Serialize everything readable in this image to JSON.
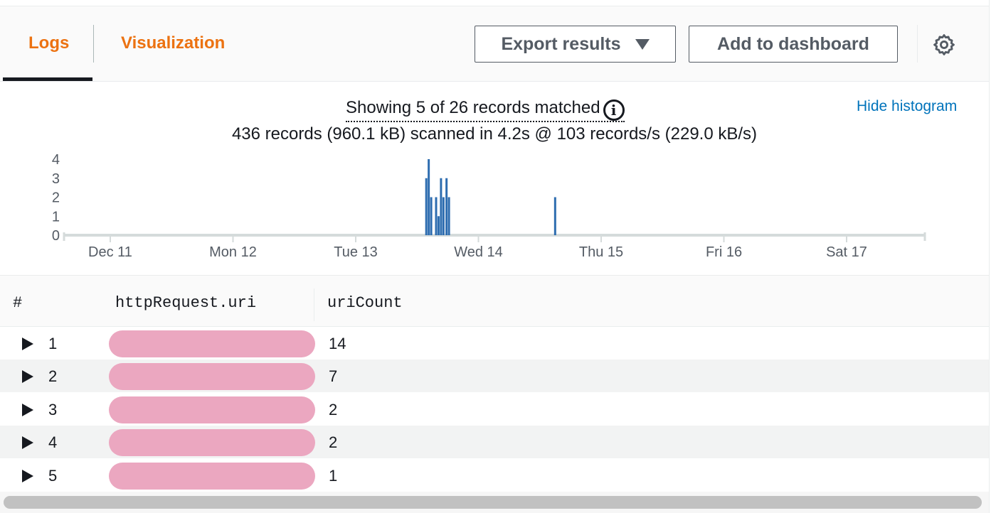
{
  "tabs": [
    {
      "label": "Logs",
      "active": true
    },
    {
      "label": "Visualization",
      "active": false
    }
  ],
  "toolbar": {
    "export_label": "Export results",
    "dashboard_label": "Add to dashboard",
    "settings_icon": "gear-icon"
  },
  "summary": {
    "matched": "Showing 5 of 26 records matched",
    "info_icon": "info-icon",
    "stats": "436 records (960.1 kB) scanned in 4.2s @ 103 records/s (229.0 kB/s)",
    "hide_histogram": "Hide histogram"
  },
  "chart_data": {
    "type": "bar",
    "y_ticks": [
      "0",
      "1",
      "2",
      "3",
      "4"
    ],
    "ylim": [
      0,
      4
    ],
    "x_ticks": [
      "Dec 11",
      "Mon 12",
      "Tue 13",
      "Wed 14",
      "Thu 15",
      "Fri 16",
      "Sat 17"
    ],
    "xlim": [
      0,
      7
    ],
    "bars": [
      {
        "x": 2.575,
        "value": 3
      },
      {
        "x": 2.595,
        "value": 4
      },
      {
        "x": 2.615,
        "value": 2
      },
      {
        "x": 2.655,
        "value": 2
      },
      {
        "x": 2.675,
        "value": 1
      },
      {
        "x": 2.695,
        "value": 3
      },
      {
        "x": 2.715,
        "value": 2
      },
      {
        "x": 2.74,
        "value": 3
      },
      {
        "x": 2.76,
        "value": 2
      },
      {
        "x": 3.625,
        "value": 2
      }
    ],
    "color": "#2e6db0"
  },
  "table": {
    "headers": [
      "#",
      "httpRequest.uri",
      "uriCount"
    ],
    "rows": [
      {
        "num": "1",
        "count": "14"
      },
      {
        "num": "2",
        "count": "7"
      },
      {
        "num": "3",
        "count": "2"
      },
      {
        "num": "4",
        "count": "2"
      },
      {
        "num": "5",
        "count": "1"
      }
    ]
  },
  "colors": {
    "accent": "#ec7211",
    "link": "#0073bb",
    "bar": "#2e6db0",
    "redaction": "#eba7c0"
  }
}
